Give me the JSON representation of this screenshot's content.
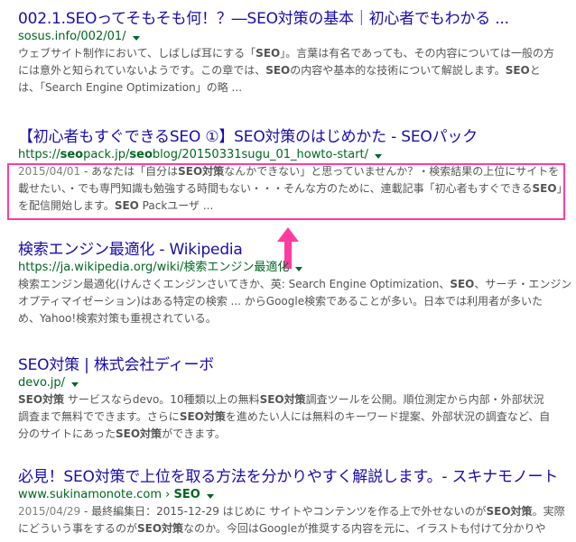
{
  "results": [
    {
      "title": "002.1.SEOってそもそも何！？―SEO対策の基本｜初心者でもわかる ...",
      "url": "sosus.info/002/01/",
      "snippet_lines": [
        "ウェブサイト制作において、しばしば耳にする「SEO」。言葉は有名であっても、その内容については一般の方",
        "には意外と知られていないようです。この章では、SEOの内容や基本的な技術について解説します。SEOと",
        "は、「Search Engine Optimization」の略 ..."
      ]
    },
    {
      "title": "【初心者もすぐできるSEO ①】SEO対策のはじめかた - SEOパック",
      "url": "https://seopack.jp/seoblog/20150331sugu_01_howto-start/",
      "date": "2015/04/01",
      "snippet_lines": [
        " - あなたは「自分はSEO対策なんかできない」と思っていませんか？・検索結果の上位にサイトを",
        "載せたい、・でも専門知識も勉強する時間もない・・・そんな方のために、連載記事「初心者もすぐできるSEO」",
        "を配信開始します。SEO Packユーザ ..."
      ]
    },
    {
      "title": "検索エンジン最適化 - Wikipedia",
      "url": "https://ja.wikipedia.org/wiki/検索エンジン最適化",
      "snippet_lines": [
        "検索エンジン最適化(けんさくエンジンさいてきか、英: Search Engine Optimization、SEO、サーチ・エンジン・",
        "オプティマイゼーション)はある特定の検索 ... からGoogle検索であることが多い。日本では利用者が多いた",
        "め、Yahoo!検索対策も重視されている。"
      ]
    },
    {
      "title": "SEO対策 | 株式会社ディーボ",
      "url": "devo.jp/",
      "snippet_lines": [
        "SEO対策 サービスならdevo。10種類以上の無料SEO対策調査ツールを公開。順位測定から内部・外部状況",
        "調査まで無料でできます。さらにSEO対策を進めたい人には無料のキーワード提案、外部状況の調査など、自",
        "分のサイトにあったSEO対策ができます。"
      ]
    },
    {
      "title": "必見！SEO対策で上位を取る方法を分かりやすく解説します。- スキナモノート",
      "url": "www.sukinamonote.com › SEO",
      "date": "2015/04/29",
      "snippet_lines": [
        " - 最終編集日：2015-12-29 はじめに サイトやコンテンツを作る上で外せないのがSEO対策。実際",
        "にどういう事をするのがSEO対策なのか。今回はGoogleが推奨する内容を元に、イラストも付けて分かりや"
      ]
    }
  ],
  "colors": {
    "title": "#1a0dab",
    "url": "#006621",
    "snippet": "#545454",
    "highlight": "#ff3ba0"
  },
  "icons": {
    "url_menu": "caret-down-icon",
    "annotation": "up-arrow-icon"
  }
}
